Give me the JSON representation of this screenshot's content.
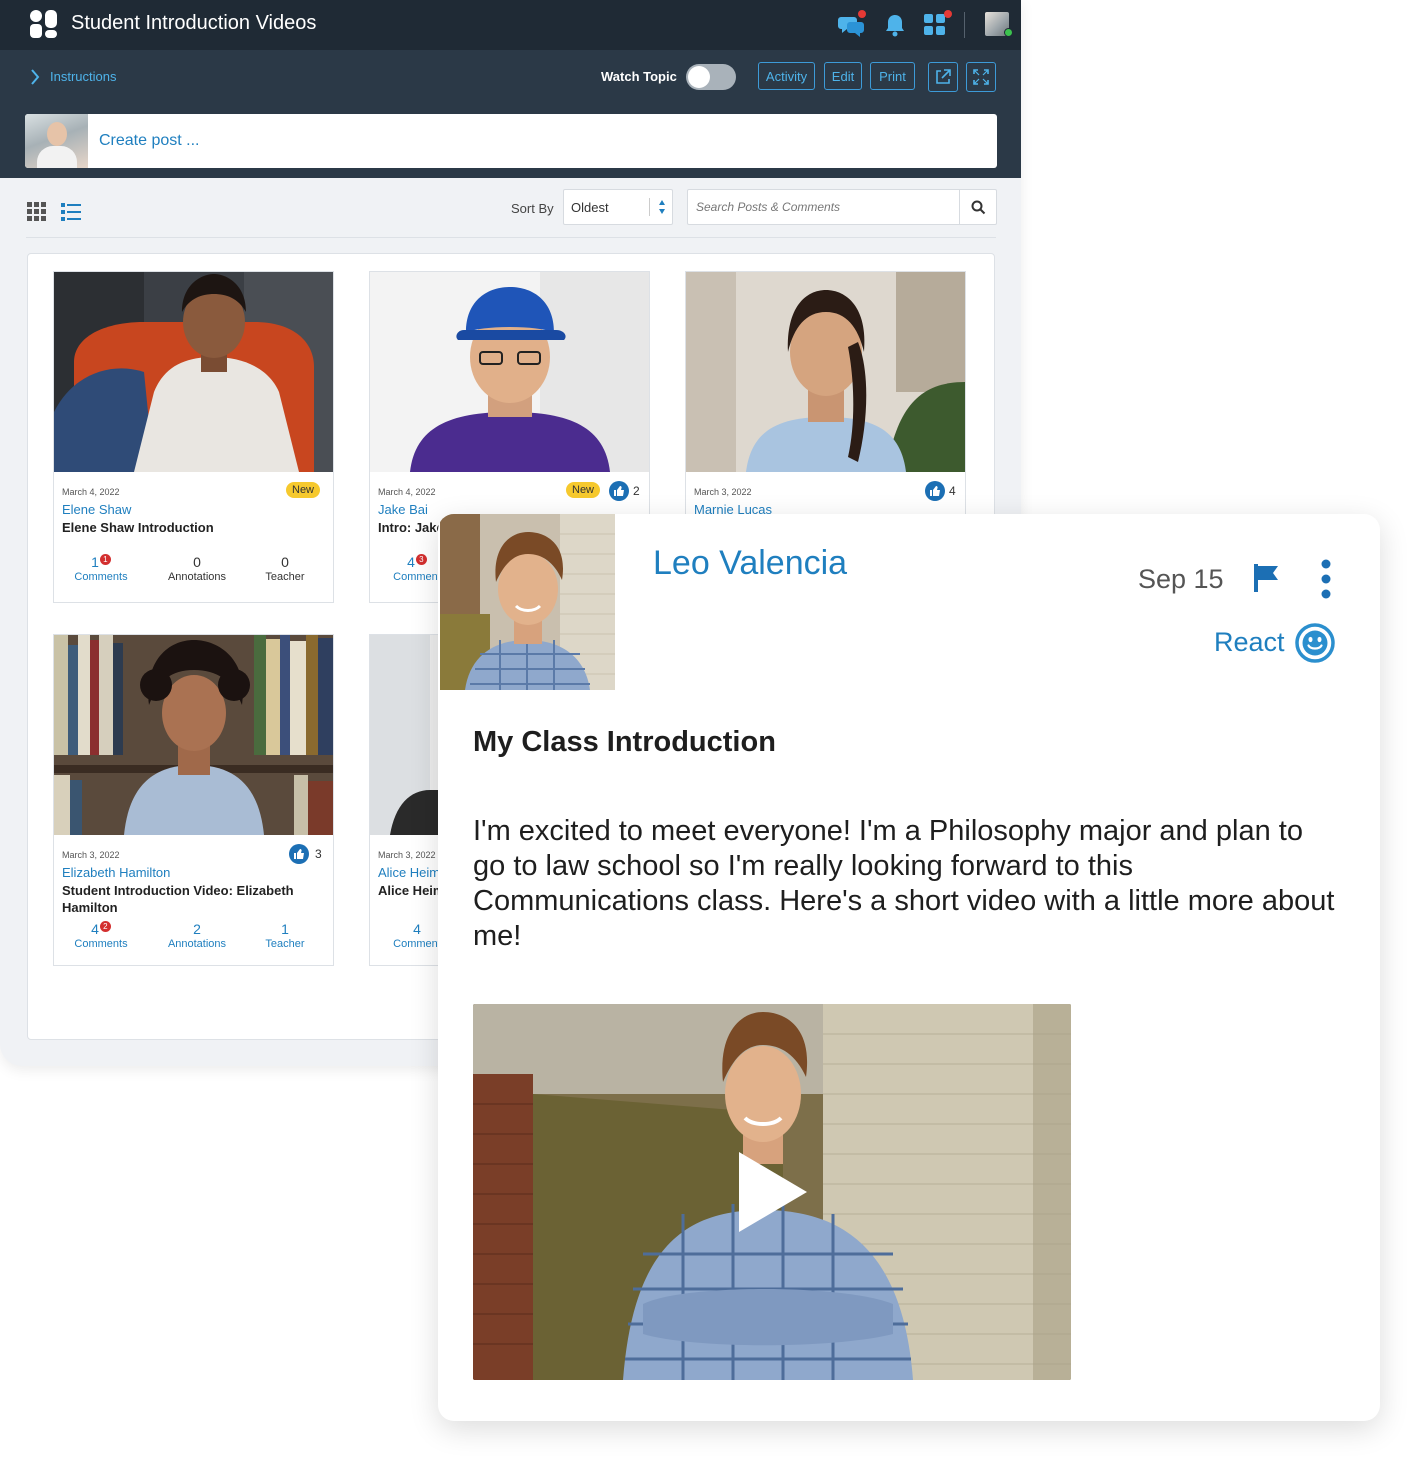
{
  "app": {
    "title": "Student Introduction Videos"
  },
  "breadcrumb": {
    "label": "Instructions"
  },
  "toolbar": {
    "watch_label": "Watch Topic",
    "watch_on": false,
    "activity_label": "Activity",
    "edit_label": "Edit",
    "print_label": "Print"
  },
  "composer": {
    "placeholder": "Create post ..."
  },
  "filters": {
    "sort_label": "Sort By",
    "sort_value": "Oldest",
    "search_placeholder": "Search Posts & Comments"
  },
  "cards": [
    {
      "date": "March 4, 2022",
      "badge": "New",
      "author": "Elene Shaw",
      "title": "Elene Shaw Introduction",
      "comments": "1",
      "comments_new": "1",
      "comments_label": "Comments",
      "annotations": "0",
      "annotations_label": "Annotations",
      "teacher": "0",
      "teacher_label": "Teacher"
    },
    {
      "date": "March 4, 2022",
      "badge": "New",
      "likes": "2",
      "author": "Jake Bai",
      "title": "Intro: Jake",
      "comments": "4",
      "comments_new": "3",
      "comments_label": "Comment"
    },
    {
      "date": "March 3, 2022",
      "likes": "4",
      "author": "Marnie Lucas"
    },
    {
      "date": "March 3, 2022",
      "likes": "3",
      "author": "Elizabeth Hamilton",
      "title": "Student Introduction Video: Elizabeth Hamilton",
      "comments": "4",
      "comments_new": "2",
      "comments_label": "Comments",
      "annotations": "2",
      "annotations_label": "Annotations",
      "teacher": "1",
      "teacher_label": "Teacher"
    },
    {
      "date": "March 3, 2022",
      "author": "Alice Heim",
      "title": "Alice Heim",
      "comments": "4",
      "comments_label": "Comment"
    }
  ],
  "post": {
    "author": "Leo Valencia",
    "date": "Sep 15",
    "react_label": "React",
    "title": "My Class Introduction",
    "body": "I'm excited to meet everyone! I'm a Philosophy major and plan to go to law school so I'm really looking forward to this Communications class.  Here's a short video with a little more about me!"
  },
  "colors": {
    "topbar": "#1f2a35",
    "subbar": "#2b3947",
    "accent": "#1f7fbf",
    "link": "#4eb3ea",
    "badge": "#f6c92e",
    "notification": "#e53935"
  }
}
